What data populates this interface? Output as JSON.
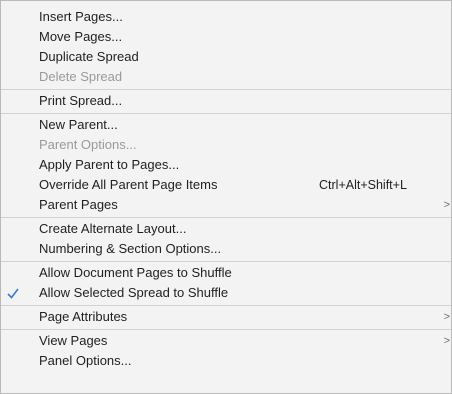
{
  "colors": {
    "menu_bg": "#f3f3f3",
    "text": "#1f1f1f",
    "disabled_text": "#9a9a9a",
    "separator": "#d2d2d2",
    "check": "#3a7bd5"
  },
  "menu": {
    "groups": [
      {
        "items": [
          {
            "label": "Insert Pages..."
          },
          {
            "label": "Move Pages..."
          },
          {
            "label": "Duplicate Spread"
          },
          {
            "label": "Delete Spread",
            "disabled": true
          }
        ]
      },
      {
        "items": [
          {
            "label": "Print Spread..."
          }
        ]
      },
      {
        "items": [
          {
            "label": "New Parent..."
          },
          {
            "label": "Parent Options...",
            "disabled": true
          },
          {
            "label": "Apply Parent to Pages..."
          },
          {
            "label": "Override All Parent Page Items",
            "shortcut": "Ctrl+Alt+Shift+L"
          },
          {
            "label": "Parent Pages",
            "submenu_icon": "chevron-right-icon"
          }
        ]
      },
      {
        "items": [
          {
            "label": "Create Alternate Layout..."
          },
          {
            "label": "Numbering & Section Options..."
          }
        ]
      },
      {
        "items": [
          {
            "label": "Allow Document Pages to Shuffle"
          },
          {
            "label": "Allow Selected Spread to Shuffle",
            "checked": true,
            "check_icon": "checkmark-icon"
          }
        ]
      },
      {
        "items": [
          {
            "label": "Page Attributes",
            "submenu_icon": "chevron-right-icon"
          }
        ]
      },
      {
        "items": [
          {
            "label": "View Pages",
            "submenu_icon": "chevron-right-icon"
          },
          {
            "label": "Panel Options..."
          }
        ]
      }
    ],
    "submenu_glyph": ">"
  }
}
